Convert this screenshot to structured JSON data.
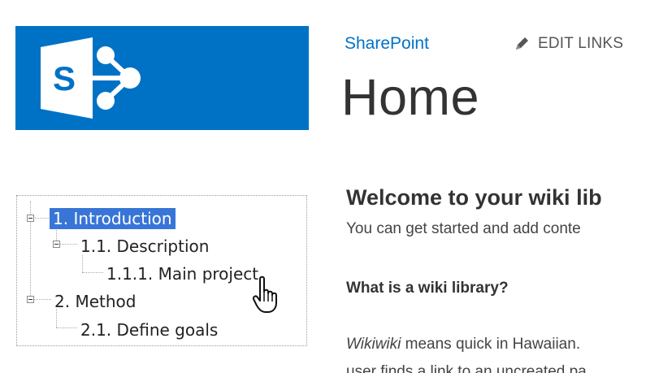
{
  "header": {
    "site_name": "SharePoint",
    "edit_links_label": "EDIT LINKS",
    "page_title": "Home"
  },
  "logo": {
    "letter": "S",
    "brand_color": "#0072c6"
  },
  "tree": {
    "nodes": [
      {
        "label": "1. Introduction",
        "selected": true,
        "expanded": true
      },
      {
        "label": "1.1. Description",
        "expanded": true
      },
      {
        "label": "1.1.1. Main project"
      },
      {
        "label": "2. Method",
        "expanded": true
      },
      {
        "label": "2.1. Define goals"
      }
    ]
  },
  "content": {
    "welcome_heading": "Welcome to your wiki lib",
    "intro_text": "You can get started and add conte",
    "subheading": "What is a wiki library?",
    "para_italic": "Wikiwiki",
    "para_rest": " means quick in Hawaiian.",
    "para_next_line": "user finds a link to an uncreated pa"
  },
  "icons": [
    "sharepoint-logo-icon",
    "pencil-icon",
    "hand-pointer-icon",
    "collapse-icon"
  ]
}
